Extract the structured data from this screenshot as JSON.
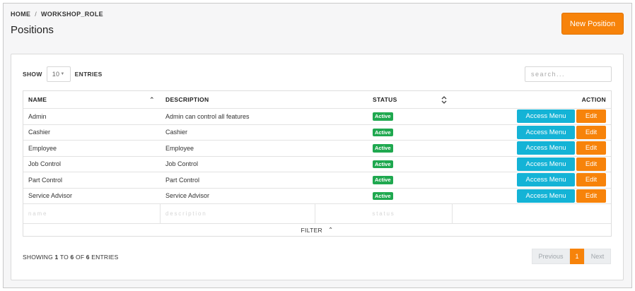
{
  "breadcrumb": {
    "home": "HOME",
    "separator": "/",
    "current": "WORKSHOP_ROLE"
  },
  "page": {
    "title": "Positions",
    "new_button": "New Position"
  },
  "controls": {
    "show_label": "SHOW",
    "entries_value": "10",
    "entries_label": "ENTRIES",
    "search_placeholder": "search..."
  },
  "table": {
    "columns": {
      "name": "NAME",
      "description": "DESCRIPTION",
      "status": "STATUS",
      "action": "ACTION"
    },
    "rows": [
      {
        "name": "Admin",
        "description": "Admin can control all features",
        "status": "Active"
      },
      {
        "name": "Cashier",
        "description": "Cashier",
        "status": "Active"
      },
      {
        "name": "Employee",
        "description": "Employee",
        "status": "Active"
      },
      {
        "name": "Job Control",
        "description": "Job Control",
        "status": "Active"
      },
      {
        "name": "Part Control",
        "description": "Part Control",
        "status": "Active"
      },
      {
        "name": "Service Advisor",
        "description": "Service Advisor",
        "status": "Active"
      }
    ],
    "row_actions": {
      "access": "Access Menu",
      "edit": "Edit"
    },
    "filter_placeholders": {
      "name": "name",
      "description": "description",
      "status": "status"
    },
    "filter_label": "FILTER"
  },
  "footer": {
    "showing_prefix": "SHOWING",
    "from": "1",
    "to_word": "TO",
    "to": "6",
    "of_word": "OF",
    "total": "6",
    "suffix": "ENTRIES"
  },
  "pagination": {
    "previous": "Previous",
    "current": "1",
    "next": "Next"
  },
  "colors": {
    "accent": "#f7830a",
    "info": "#14b3d6",
    "success": "#1fa84f"
  },
  "icons": {
    "sort_name": "chevron-up-icon",
    "sort_status": "sort-both-icon",
    "entries_caret": "caret-down-icon",
    "filter_toggle": "chevron-up-icon"
  }
}
